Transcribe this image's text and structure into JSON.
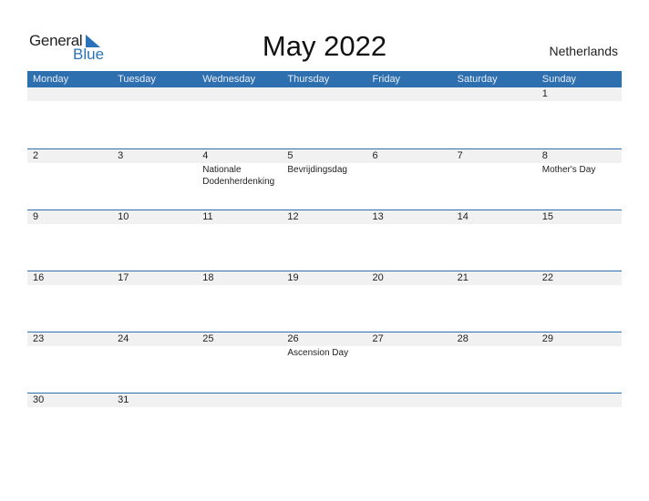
{
  "logo": {
    "general": "General",
    "blue": "Blue"
  },
  "title": "May 2022",
  "country": "Netherlands",
  "weekdays": [
    "Monday",
    "Tuesday",
    "Wednesday",
    "Thursday",
    "Friday",
    "Saturday",
    "Sunday"
  ],
  "weeks": [
    [
      {
        "d": "",
        "e": ""
      },
      {
        "d": "",
        "e": ""
      },
      {
        "d": "",
        "e": ""
      },
      {
        "d": "",
        "e": ""
      },
      {
        "d": "",
        "e": ""
      },
      {
        "d": "",
        "e": ""
      },
      {
        "d": "1",
        "e": ""
      }
    ],
    [
      {
        "d": "2",
        "e": ""
      },
      {
        "d": "3",
        "e": ""
      },
      {
        "d": "4",
        "e": "Nationale Dodenherdenking"
      },
      {
        "d": "5",
        "e": "Bevrijdingsdag"
      },
      {
        "d": "6",
        "e": ""
      },
      {
        "d": "7",
        "e": ""
      },
      {
        "d": "8",
        "e": "Mother's Day"
      }
    ],
    [
      {
        "d": "9",
        "e": ""
      },
      {
        "d": "10",
        "e": ""
      },
      {
        "d": "11",
        "e": ""
      },
      {
        "d": "12",
        "e": ""
      },
      {
        "d": "13",
        "e": ""
      },
      {
        "d": "14",
        "e": ""
      },
      {
        "d": "15",
        "e": ""
      }
    ],
    [
      {
        "d": "16",
        "e": ""
      },
      {
        "d": "17",
        "e": ""
      },
      {
        "d": "18",
        "e": ""
      },
      {
        "d": "19",
        "e": ""
      },
      {
        "d": "20",
        "e": ""
      },
      {
        "d": "21",
        "e": ""
      },
      {
        "d": "22",
        "e": ""
      }
    ],
    [
      {
        "d": "23",
        "e": ""
      },
      {
        "d": "24",
        "e": ""
      },
      {
        "d": "25",
        "e": ""
      },
      {
        "d": "26",
        "e": "Ascension Day"
      },
      {
        "d": "27",
        "e": ""
      },
      {
        "d": "28",
        "e": ""
      },
      {
        "d": "29",
        "e": ""
      }
    ],
    [
      {
        "d": "30",
        "e": ""
      },
      {
        "d": "31",
        "e": ""
      },
      {
        "d": "",
        "e": ""
      },
      {
        "d": "",
        "e": ""
      },
      {
        "d": "",
        "e": ""
      },
      {
        "d": "",
        "e": ""
      },
      {
        "d": "",
        "e": ""
      }
    ]
  ]
}
